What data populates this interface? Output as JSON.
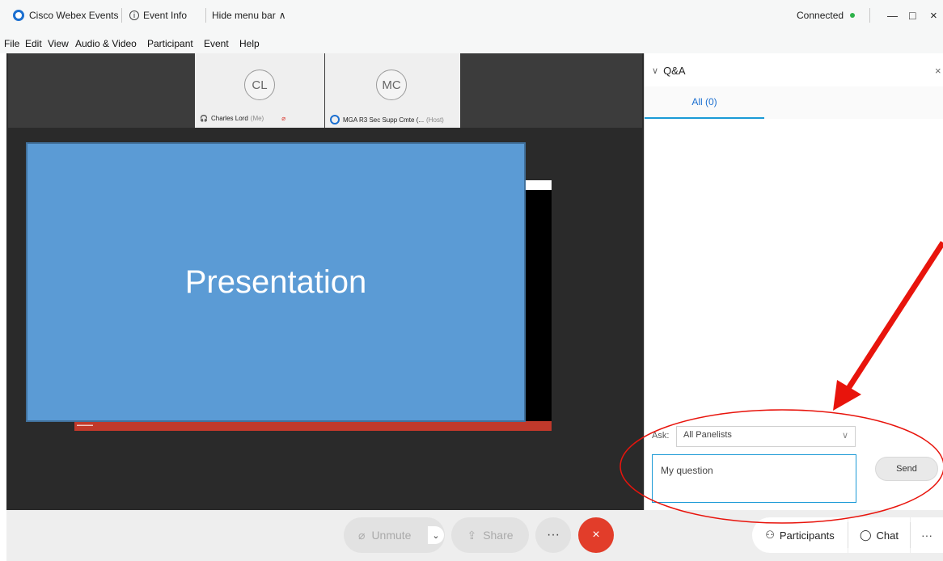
{
  "titlebar": {
    "app_name": "Cisco Webex Events",
    "event_info": "Event Info",
    "hide_menu_bar": "Hide menu bar",
    "hide_menu_chevron": "∧",
    "status": "Connected",
    "minimize": "—",
    "maximize": "□",
    "close": "×",
    "status_color": "#2eb24a"
  },
  "menu": {
    "items": [
      "File",
      "Edit",
      "View",
      "Audio & Video",
      "Participant",
      "Event",
      "Help"
    ]
  },
  "videos": [
    {
      "initials": "CL",
      "name": "Charles Lord",
      "role": "(Me)"
    },
    {
      "initials": "MC",
      "name": "MGA R3 Sec Supp Cmte (...",
      "role": "(Host)"
    }
  ],
  "presentation": {
    "slide_text": "Presentation",
    "slide_color": "#5b9bd5"
  },
  "qa": {
    "title": "Q&A",
    "title_chevron": "∨",
    "close": "×",
    "tab_all": "All (0)",
    "ask_label": "Ask:",
    "ask_value": "All Panelists",
    "ask_chevron": "∨",
    "question_placeholder": "My question",
    "send_label": "Send"
  },
  "controls": {
    "unmute": "Unmute",
    "unmute_chevron": "⌄",
    "share": "Share",
    "more": "···",
    "end": "×",
    "participants": "Participants",
    "chat": "Chat",
    "right_more": "···",
    "end_color": "#e23d2a"
  },
  "annotation": {
    "arrow_color": "#e8140c"
  }
}
